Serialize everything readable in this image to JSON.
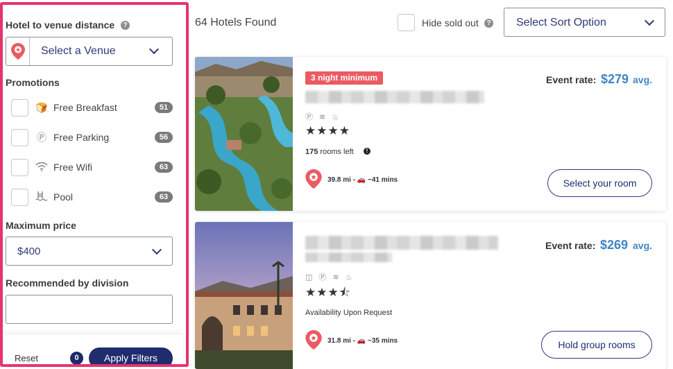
{
  "filters": {
    "distance_title": "Hotel to venue distance",
    "venue_placeholder": "Select a Venue",
    "promotions_title": "Promotions",
    "promotions": [
      {
        "label": "Free Breakfast",
        "count": "51",
        "icon": "breakfast-icon"
      },
      {
        "label": "Free Parking",
        "count": "56",
        "icon": "parking-icon"
      },
      {
        "label": "Free Wifi",
        "count": "63",
        "icon": "wifi-icon"
      },
      {
        "label": "Pool",
        "count": "63",
        "icon": "pool-icon"
      }
    ],
    "max_price_title": "Maximum price",
    "max_price_value": "$400",
    "division_title": "Recommended by division",
    "division_value": "",
    "reset_label": "Reset",
    "active_count": "0",
    "apply_label": "Apply Filters"
  },
  "results": {
    "count_text": "64 Hotels Found",
    "hide_sold_out_label": "Hide sold out",
    "sort_placeholder": "Select Sort Option"
  },
  "hotels": [
    {
      "badge": "3 night minimum",
      "stars": "★★★★",
      "availability_count": "175",
      "availability_suffix": "rooms left",
      "distance": "39.8 mi - 🚗 ~41 mins",
      "rate_label": "Event rate:",
      "rate_price": "$279",
      "rate_avg": "avg.",
      "button_label": "Select your room"
    },
    {
      "badge": "",
      "stars": "★★★⯪",
      "availability_text": "Availability Upon Request",
      "distance": "31.8 mi - 🚗 ~35 mins",
      "rate_label": "Event rate:",
      "rate_price": "$269",
      "rate_avg": "avg.",
      "button_label": "Hold group rooms"
    }
  ],
  "colors": {
    "highlight_border": "#e8336d",
    "brand_navy": "#1f2d6e",
    "price_blue": "#3f85c6",
    "badge_red": "#eb5b63"
  }
}
